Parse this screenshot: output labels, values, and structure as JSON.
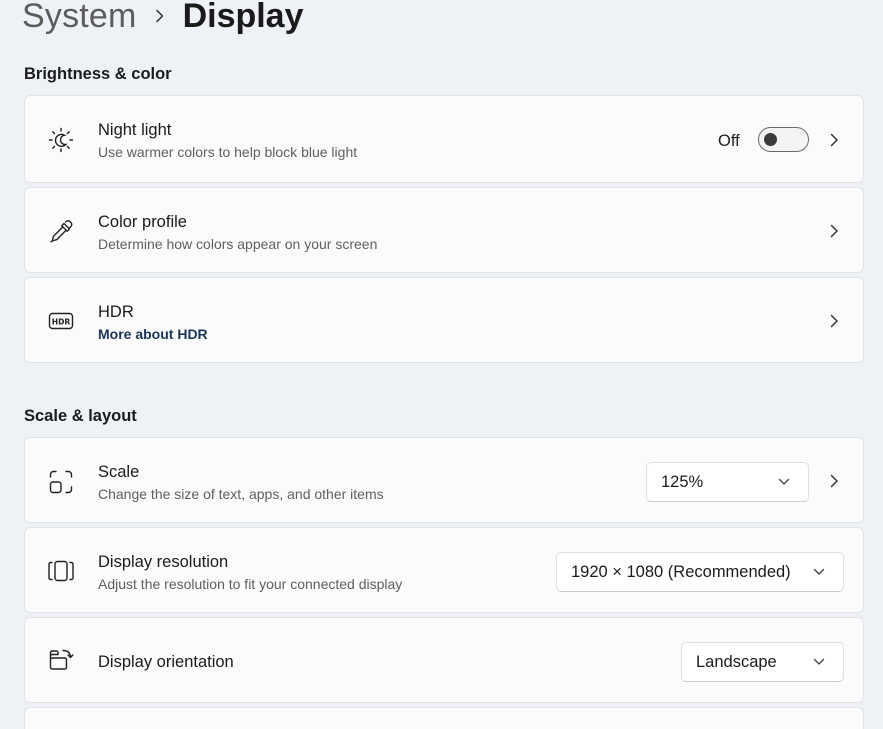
{
  "breadcrumb": {
    "parent": "System",
    "current": "Display"
  },
  "sections": {
    "brightness": "Brightness & color",
    "scale": "Scale & layout"
  },
  "night_light": {
    "title": "Night light",
    "subtitle": "Use warmer colors to help block blue light",
    "state_label": "Off",
    "toggle_on": false,
    "icon": "night-light-icon"
  },
  "color_profile": {
    "title": "Color profile",
    "subtitle": "Determine how colors appear on your screen",
    "icon": "eyedropper-icon"
  },
  "hdr": {
    "title": "HDR",
    "link": "More about HDR",
    "icon": "hdr-icon",
    "icon_text": "HDR"
  },
  "scale": {
    "title": "Scale",
    "subtitle": "Change the size of text, apps, and other items",
    "value": "125%",
    "icon": "scale-icon"
  },
  "resolution": {
    "title": "Display resolution",
    "subtitle": "Adjust the resolution to fit your connected display",
    "value": "1920 × 1080 (Recommended)",
    "icon": "resolution-icon"
  },
  "orientation": {
    "title": "Display orientation",
    "value": "Landscape",
    "icon": "orientation-icon"
  },
  "colors": {
    "background": "#eef2f7",
    "card": "#fbfbfc",
    "link": "#1b3558"
  }
}
